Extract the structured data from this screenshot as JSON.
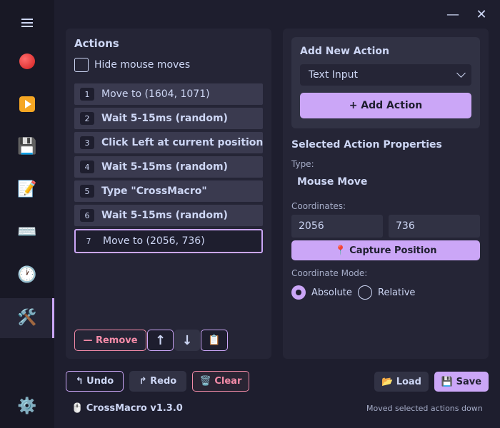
{
  "sidebar": {
    "items": [
      {
        "icon": "menu-icon"
      },
      {
        "icon": "record-icon"
      },
      {
        "icon": "play-icon",
        "emoji": "▶"
      },
      {
        "icon": "save-disk-icon",
        "emoji": "💾"
      },
      {
        "icon": "memo-icon",
        "emoji": "📝"
      },
      {
        "icon": "keyboard-icon",
        "emoji": "⌨️"
      },
      {
        "icon": "clock-icon",
        "emoji": "🕐"
      },
      {
        "icon": "tools-icon",
        "emoji": "🛠️",
        "active": true
      },
      {
        "icon": "settings-gear-icon",
        "emoji": "⚙️"
      }
    ]
  },
  "window": {
    "minimize_glyph": "—",
    "close_glyph": "✕"
  },
  "actions": {
    "title": "Actions",
    "hide_mouse_moves_label": "Hide mouse moves",
    "items": [
      {
        "num": "1",
        "label": "Move to (1604, 1071)",
        "bold": false
      },
      {
        "num": "2",
        "label": "Wait 5-15ms (random)",
        "bold": true
      },
      {
        "num": "3",
        "label": "Click Left at current position",
        "bold": true
      },
      {
        "num": "4",
        "label": "Wait 5-15ms (random)",
        "bold": true
      },
      {
        "num": "5",
        "label": "Type \"CrossMacro\"",
        "bold": true
      },
      {
        "num": "6",
        "label": "Wait 5-15ms (random)",
        "bold": true
      },
      {
        "num": "7",
        "label": "Move to (2056, 736)",
        "bold": false,
        "selected": true
      }
    ],
    "remove_label": "— Remove",
    "move_up_glyph": "↑",
    "move_down_glyph": "↓",
    "duplicate_glyph": "📋"
  },
  "add_action": {
    "title": "Add New Action",
    "selected_type": "Text Input",
    "add_button_label": "+ Add Action"
  },
  "properties": {
    "title": "Selected Action Properties",
    "type_label": "Type:",
    "type_value": "Mouse Move",
    "coordinates_label": "Coordinates:",
    "x_value": "2056",
    "y_value": "736",
    "capture_label": "📍 Capture Position",
    "mode_label": "Coordinate Mode:",
    "mode_absolute": "Absolute",
    "mode_relative": "Relative",
    "mode_selected": "absolute"
  },
  "footer": {
    "undo_label": "↰ Undo",
    "redo_label": "↱ Redo",
    "clear_label": "🗑️ Clear",
    "load_label": "📂 Load",
    "save_label": "💾 Save",
    "app_name": "🖱️ CrossMacro v1.3.0",
    "status_text": "Moved selected actions down"
  },
  "colors": {
    "accent": "#cba6f7",
    "danger": "#f38ba8",
    "background": "#1e1e2e",
    "panel": "#252536"
  }
}
